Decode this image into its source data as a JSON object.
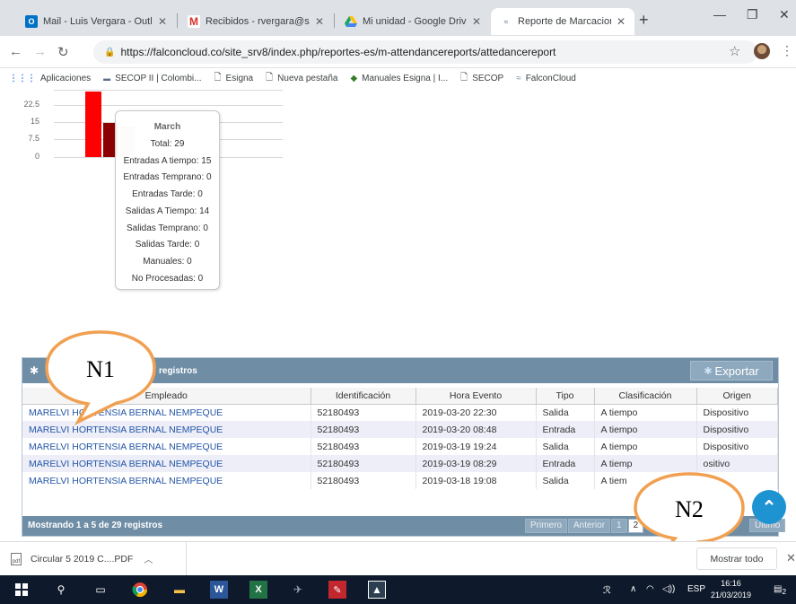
{
  "browser": {
    "tabs": [
      {
        "favicon": "outlook-icon",
        "title": "Mail - Luis Vergara - Outl",
        "color": "#0072c6"
      },
      {
        "favicon": "gmail-icon",
        "title": "Recibidos - rvergara@sup",
        "color": "#d93025"
      },
      {
        "favicon": "drive-icon",
        "title": "Mi unidad - Google Drive",
        "color": "#1fa463"
      },
      {
        "favicon": "falcon-icon",
        "title": "Reporte de Marcaciones",
        "color": "#7a8fa6"
      }
    ],
    "url": "https://falconcloud.co/site_srv8/index.php/reportes-es/m-attendancereports/attedancereport",
    "bookmarks": [
      {
        "icon": "apps-grid-icon",
        "label": "Aplicaciones"
      },
      {
        "icon": "secop-icon",
        "label": "SECOP II | Colombi..."
      },
      {
        "icon": "page-icon",
        "label": "Esigna"
      },
      {
        "icon": "page-icon",
        "label": "Nueva pestaña"
      },
      {
        "icon": "esigna-icon",
        "label": "Manuales Esigna | I..."
      },
      {
        "icon": "page-icon",
        "label": "SECOP"
      },
      {
        "icon": "falcon-icon",
        "label": "FalconCloud"
      }
    ]
  },
  "chart_data": {
    "type": "bar",
    "yticks": [
      "22.5",
      "15",
      "7.5",
      "0"
    ],
    "ylim": [
      0,
      30
    ],
    "visible_bars": [
      {
        "series": "Total",
        "value": 29,
        "color": "#ff0000"
      },
      {
        "series": "Entradas A tiempo",
        "value": 15,
        "color": "#8b0000"
      },
      {
        "series": "Salidas A Tiempo",
        "value": 14,
        "color": "#e8c4c6"
      }
    ]
  },
  "tooltip": {
    "title": "March",
    "lines": [
      "Total: 29",
      "Entradas A tiempo: 15",
      "Entradas Temprano: 0",
      "Entradas Tarde: 0",
      "Salidas A Tiempo: 14",
      "Salidas Temprano: 0",
      "Salidas Tarde: 0",
      "Manuales: 0",
      "No Procesadas: 0"
    ]
  },
  "table_panel": {
    "registros_label": "registros",
    "export_label": "Exportar",
    "columns": [
      "Empleado",
      "Identificación",
      "Hora Evento",
      "Tipo",
      "Clasificación",
      "Origen"
    ],
    "rows": [
      [
        "MARELVI HORTENSIA BERNAL NEMPEQUE",
        "52180493",
        "2019-03-20 22:30",
        "Salida",
        "A tiempo",
        "Dispositivo"
      ],
      [
        "MARELVI HORTENSIA BERNAL NEMPEQUE",
        "52180493",
        "2019-03-20 08:48",
        "Entrada",
        "A tiempo",
        "Dispositivo"
      ],
      [
        "MARELVI HORTENSIA BERNAL NEMPEQUE",
        "52180493",
        "2019-03-19 19:24",
        "Salida",
        "A tiempo",
        "Dispositivo"
      ],
      [
        "MARELVI HORTENSIA BERNAL NEMPEQUE",
        "52180493",
        "2019-03-19 08:29",
        "Entrada",
        "A tiemp",
        "ositivo"
      ],
      [
        "MARELVI HORTENSIA BERNAL NEMPEQUE",
        "52180493",
        "2019-03-18 19:08",
        "Salida",
        "A tiem",
        ""
      ]
    ],
    "showing": "Mostrando 1 a 5 de 29 registros",
    "pager": {
      "first": "Primero",
      "prev": "Anterior",
      "page1": "1",
      "page2": "2",
      "last": "Último"
    }
  },
  "callouts": {
    "n1": "N1",
    "n2": "N2"
  },
  "download_bar": {
    "file": "Circular 5 2019 C....PDF",
    "show_all": "Mostrar todo"
  },
  "taskbar": {
    "lang": "ESP",
    "time": "16:16",
    "date": "21/03/2019",
    "notif_count": "2"
  }
}
